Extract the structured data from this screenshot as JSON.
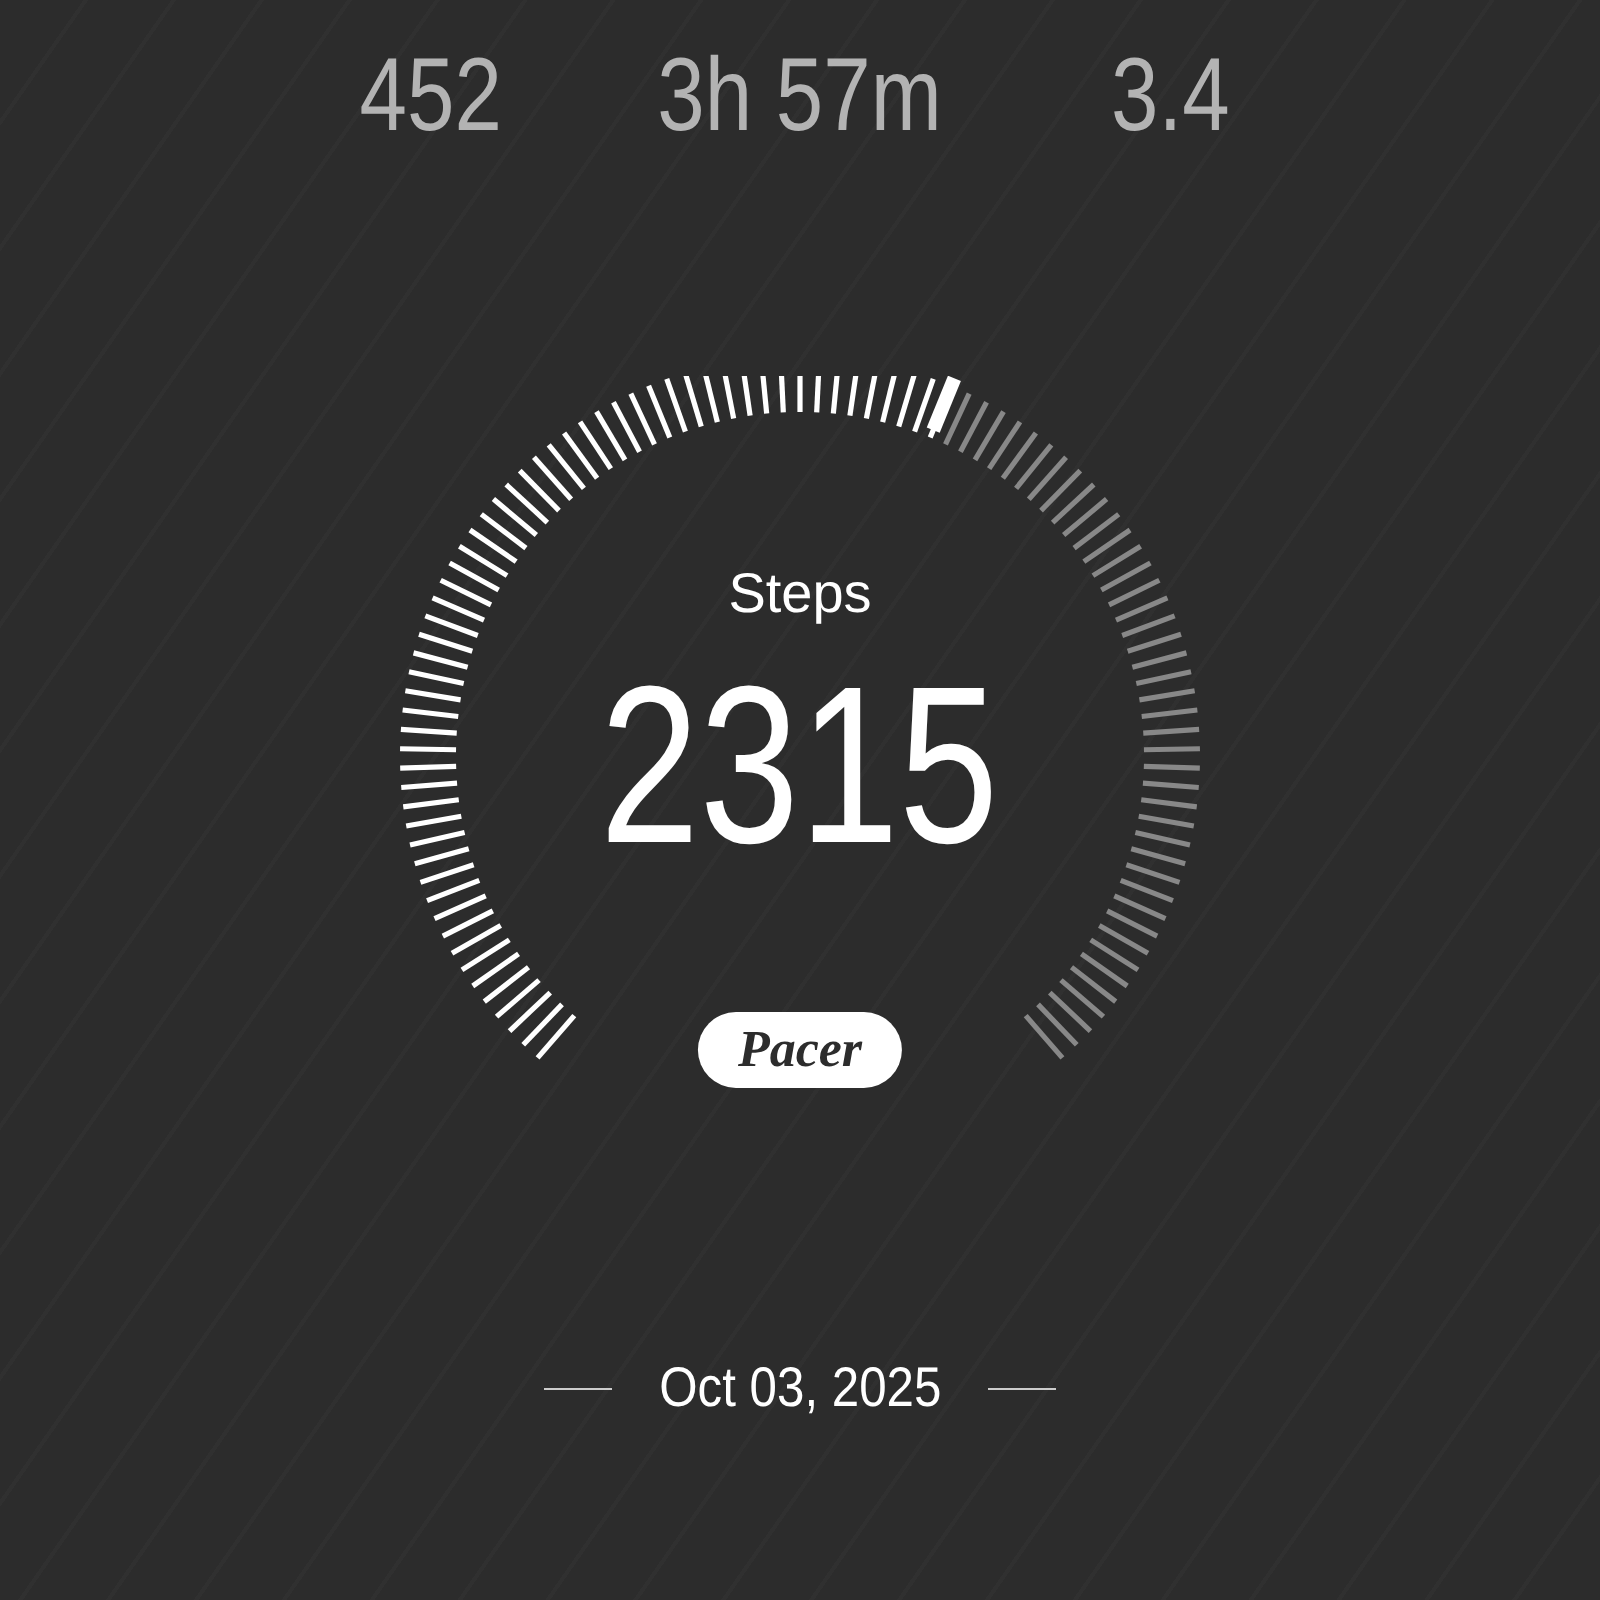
{
  "stats": [
    {
      "value": "452"
    },
    {
      "value": "3h 57m"
    },
    {
      "value": "3.4"
    }
  ],
  "steps": {
    "label": "Steps",
    "value": "2315"
  },
  "brand": {
    "label": "Pacer"
  },
  "date": "Oct 03, 2025"
}
